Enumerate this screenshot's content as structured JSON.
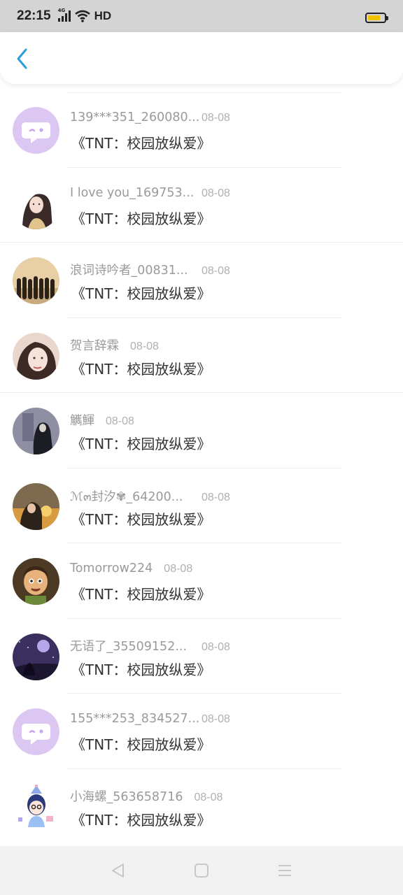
{
  "status_bar": {
    "time": "22:15",
    "network": "4G",
    "hd": "HD",
    "battery_level": 0.75,
    "battery_color": "#f2c200"
  },
  "header": {
    "back_icon": "chevron-left-icon",
    "accent_color": "#2a9fd8"
  },
  "list": {
    "items": [
      {
        "name": "139***351_260080...",
        "date": "08-08",
        "title": "《TNT：校园放纵爱》",
        "avatar": "default-chat-avatar"
      },
      {
        "name": "I love you_169753...",
        "date": "08-08",
        "title": "《TNT：校园放纵爱》",
        "avatar": "illustrated-girl-avatar"
      },
      {
        "name": "浪词诗吟者_00831...",
        "date": "08-08",
        "title": "《TNT：校园放纵爱》",
        "avatar": "group-silhouette-avatar"
      },
      {
        "name": "贺言辞霖",
        "date": "08-08",
        "title": "《TNT：校园放纵爱》",
        "avatar": "girl-photo-avatar"
      },
      {
        "name": "觽鯶",
        "date": "08-08",
        "title": "《TNT：校园放纵爱》",
        "avatar": "dark-figure-avatar"
      },
      {
        "name": "ℳ๓封汐✾_64200...",
        "date": "08-08",
        "title": "《TNT：校园放纵爱》",
        "avatar": "sunset-girl-avatar"
      },
      {
        "name": "Tomorrow224",
        "date": "08-08",
        "title": "《TNT：校园放纵爱》",
        "avatar": "cartoon-boy-avatar"
      },
      {
        "name": "无语了_35509152...",
        "date": "08-08",
        "title": "《TNT：校园放纵爱》",
        "avatar": "purple-night-avatar"
      },
      {
        "name": "155***253_834527...",
        "date": "08-08",
        "title": "《TNT：校园放纵爱》",
        "avatar": "default-chat-avatar"
      },
      {
        "name": "小海螺_563658716",
        "date": "08-08",
        "title": "《TNT：校园放纵爱》",
        "avatar": "birthday-cartoon-avatar"
      }
    ]
  },
  "navbar": {
    "back_icon": "triangle-back-icon",
    "home_icon": "square-home-icon",
    "menu_icon": "three-lines-menu-icon"
  }
}
